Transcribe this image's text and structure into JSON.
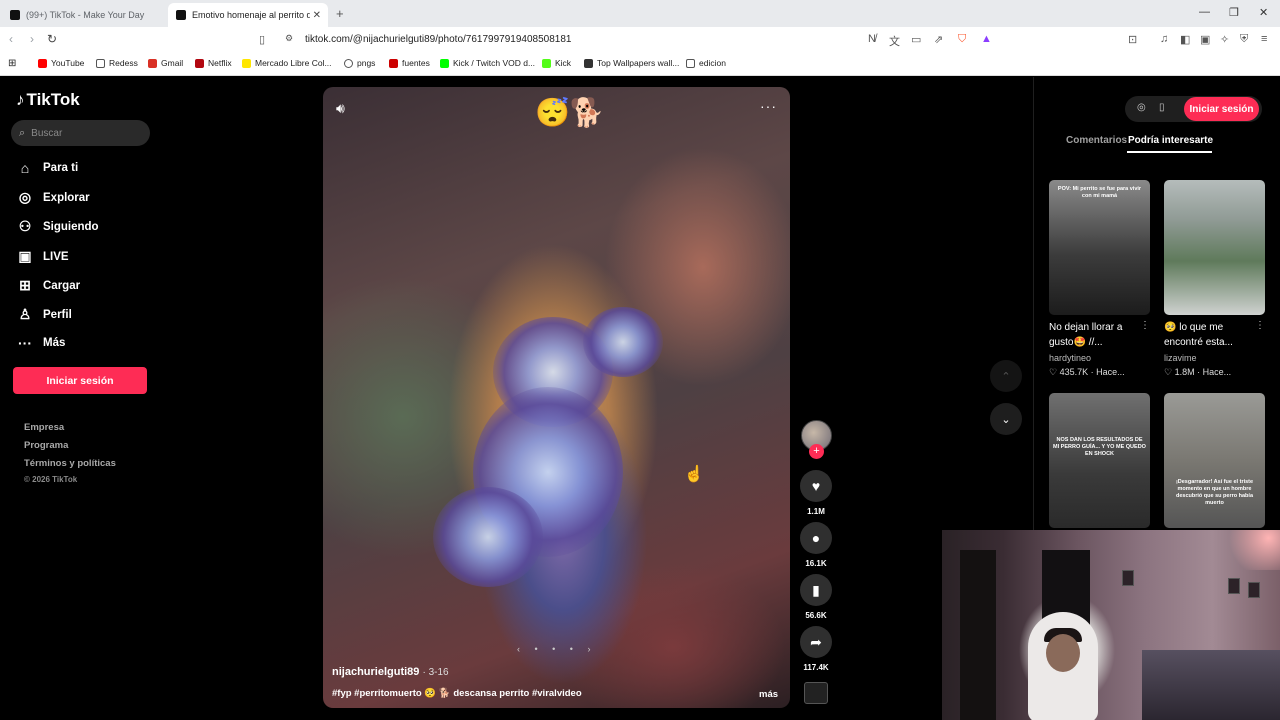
{
  "browser": {
    "tabs": [
      {
        "title": "(99+) TikTok - Make Your Day",
        "active": false
      },
      {
        "title": "Emotivo homenaje al perrito qu",
        "active": true
      }
    ],
    "url": "tiktok.com/@nijachurielguti89/photo/7617997919408508181",
    "bookmarks": [
      "YouTube",
      "Redess",
      "Gmail",
      "Netflix",
      "Mercado Libre Col...",
      "pngs",
      "fuentes",
      "Kick / Twitch VOD d...",
      "Kick",
      "Top Wallpapers wall...",
      "edicion"
    ]
  },
  "sidebar": {
    "logo": "TikTok",
    "search_placeholder": "Buscar",
    "items": [
      {
        "label": "Para ti",
        "icon": "home-icon"
      },
      {
        "label": "Explorar",
        "icon": "compass-icon"
      },
      {
        "label": "Siguiendo",
        "icon": "following-icon"
      },
      {
        "label": "LIVE",
        "icon": "live-icon"
      },
      {
        "label": "Cargar",
        "icon": "upload-icon"
      },
      {
        "label": "Perfil",
        "icon": "profile-icon"
      },
      {
        "label": "Más",
        "icon": "more-icon"
      }
    ],
    "login_label": "Iniciar sesión",
    "footer_links": [
      "Empresa",
      "Programa",
      "Términos y políticas"
    ],
    "copyright": "© 2026 TikTok"
  },
  "post": {
    "author": "nijachurielguti89",
    "date": "3-16",
    "caption": "#fyp #perritomuerto 🥺 🐕 descansa perrito #viralvideo",
    "more_label": "más",
    "emoji_overlay": "😴🐕",
    "slide_indicator": "‹ • • • ›"
  },
  "actions": {
    "likes": "1.1M",
    "comments": "16.1K",
    "saves": "56.6K",
    "shares": "117.4K"
  },
  "right_panel": {
    "login_label": "Iniciar sesión",
    "tabs": [
      "Comentarios",
      "Podría interesarte"
    ],
    "active_tab": "Podría interesarte",
    "cards": [
      {
        "title": "No dejan llorar a gusto🤩 //...",
        "user": "hardytineo",
        "likes": "435.7K",
        "time": "Hace...",
        "overlay": "POV: Mi perrito se fue para vivir con mi mamá",
        "bg": "#6b6b6b"
      },
      {
        "title": "🥺 lo que me encontré esta...",
        "user": "lizavime",
        "likes": "1.8M",
        "time": "Hace...",
        "overlay": "",
        "bg": "#9fa9a6"
      },
      {
        "title": "",
        "user": "",
        "likes": "",
        "time": "",
        "overlay": "NOS DAN LOS RESULTADOS DE MI PERRO GUÍA... Y YO ME QUEDO EN SHOCK",
        "bg": "#4d4d4d"
      },
      {
        "title": "",
        "user": "",
        "likes": "",
        "time": "",
        "overlay": "¡Desgarrador! Así fue el triste momento en que un hombre descubrió que su perro había muerto",
        "bg": "#7b7b78"
      }
    ]
  },
  "colors": {
    "accent": "#fe2c55",
    "background": "#000000"
  }
}
